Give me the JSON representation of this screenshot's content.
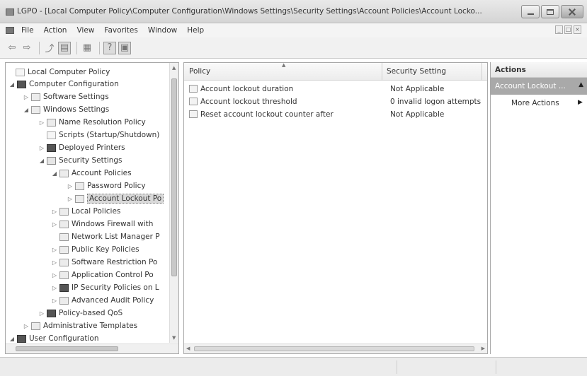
{
  "window": {
    "title": "LGPO - [Local Computer Policy\\Computer Configuration\\Windows Settings\\Security Settings\\Account Policies\\Account Locko..."
  },
  "menubar": {
    "items": [
      "File",
      "Action",
      "View",
      "Favorites",
      "Window",
      "Help"
    ]
  },
  "toolbar": {
    "buttons": [
      "back-arrow",
      "forward-arrow",
      "up-folder",
      "show-hide-tree",
      "export-list",
      "help",
      "properties"
    ]
  },
  "tree": {
    "nodes": [
      {
        "label": "Local Computer Policy",
        "icon": "policy-icon",
        "expander": ""
      },
      {
        "label": "Computer Configuration",
        "icon": "computer-icon",
        "expander": "◢"
      },
      {
        "label": "Software Settings",
        "icon": "folder-icon",
        "expander": "▷"
      },
      {
        "label": "Windows Settings",
        "icon": "folder-icon",
        "expander": "◢"
      },
      {
        "label": "Name Resolution Policy",
        "icon": "folder-icon",
        "expander": "▷"
      },
      {
        "label": "Scripts (Startup/Shutdown)",
        "icon": "script-icon",
        "expander": ""
      },
      {
        "label": "Deployed Printers",
        "icon": "printer-icon",
        "expander": "▷"
      },
      {
        "label": "Security Settings",
        "icon": "security-icon",
        "expander": "◢"
      },
      {
        "label": "Account Policies",
        "icon": "folder-icon",
        "expander": "◢"
      },
      {
        "label": "Password Policy",
        "icon": "folder-icon",
        "expander": "▷"
      },
      {
        "label": "Account Lockout Po",
        "icon": "folder-icon",
        "expander": "▷"
      },
      {
        "label": "Local Policies",
        "icon": "folder-icon",
        "expander": "▷"
      },
      {
        "label": "Windows Firewall with",
        "icon": "folder-icon",
        "expander": "▷"
      },
      {
        "label": "Network List Manager P",
        "icon": "folder-icon",
        "expander": ""
      },
      {
        "label": "Public Key Policies",
        "icon": "folder-icon",
        "expander": "▷"
      },
      {
        "label": "Software Restriction Po",
        "icon": "folder-icon",
        "expander": "▷"
      },
      {
        "label": "Application Control Po",
        "icon": "folder-icon",
        "expander": "▷"
      },
      {
        "label": "IP Security Policies on L",
        "icon": "ipsec-icon",
        "expander": "▷"
      },
      {
        "label": "Advanced Audit Policy",
        "icon": "folder-icon",
        "expander": "▷"
      },
      {
        "label": "Policy-based QoS",
        "icon": "qos-icon",
        "expander": "▷"
      },
      {
        "label": "Administrative Templates",
        "icon": "folder-icon",
        "expander": "▷"
      },
      {
        "label": "User Configuration",
        "icon": "user-icon",
        "expander": "◢"
      }
    ]
  },
  "list": {
    "columns": [
      "Policy",
      "Security Setting"
    ],
    "rows": [
      {
        "policy": "Account lockout duration",
        "setting": "Not Applicable"
      },
      {
        "policy": "Account lockout threshold",
        "setting": "0 invalid logon attempts"
      },
      {
        "policy": "Reset account lockout counter after",
        "setting": "Not Applicable"
      }
    ]
  },
  "actions": {
    "title": "Actions",
    "section": "Account Lockout ...",
    "more": "More Actions"
  }
}
